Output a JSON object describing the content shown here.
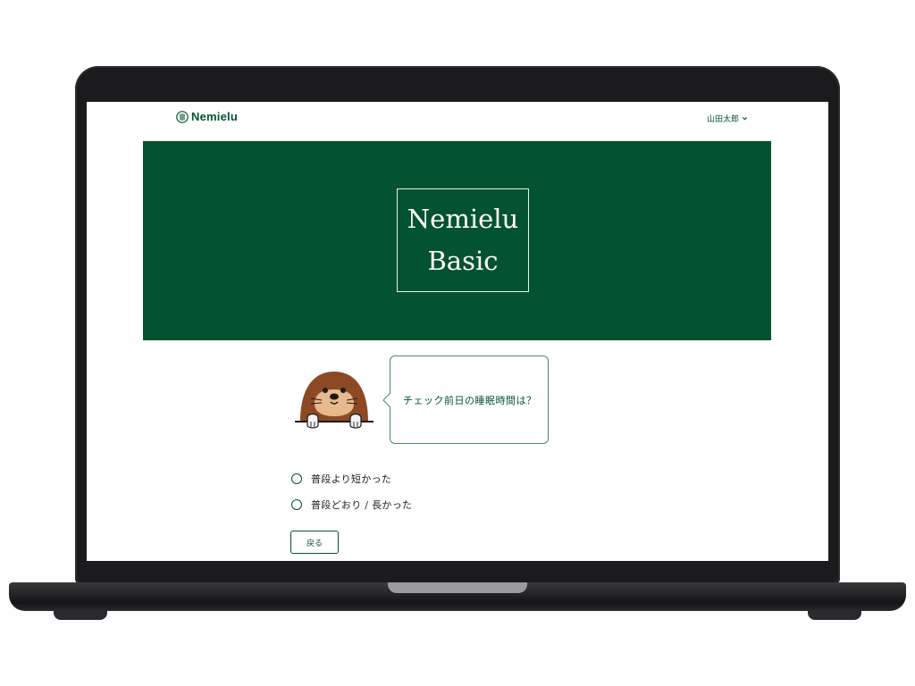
{
  "header": {
    "logo_text": "Nemielu",
    "user_name": "山田太郎"
  },
  "banner": {
    "title_line1": "Nemielu",
    "title_line2": "Basic"
  },
  "question": {
    "text": "チェック前日の睡眠時間は？"
  },
  "options": [
    {
      "label": "普段より短かった"
    },
    {
      "label": "普段どおり / 長かった"
    }
  ],
  "actions": {
    "back_label": "戻る"
  },
  "colors": {
    "brand_green": "#045330",
    "bubble_border": "#4a8a69",
    "mole_brown": "#8b4a24"
  }
}
